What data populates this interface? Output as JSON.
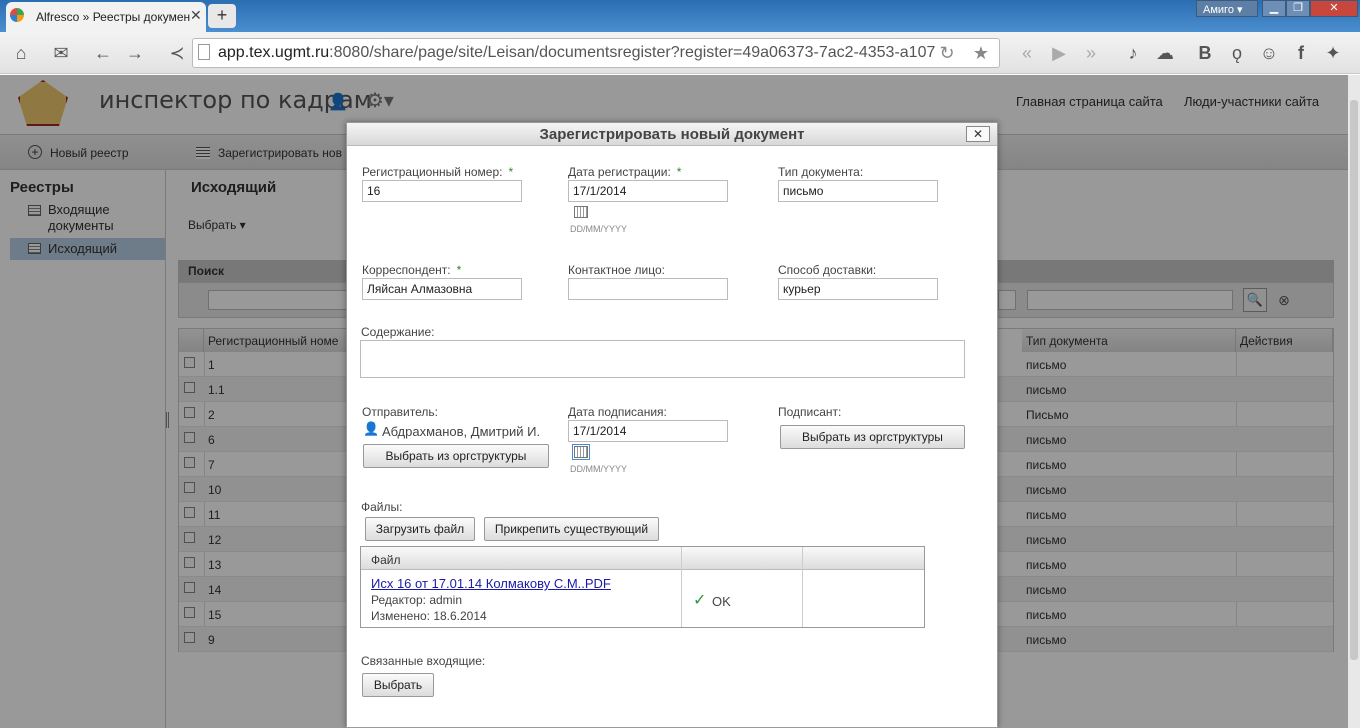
{
  "browser": {
    "tab_title": "Alfresco » Реестры докумен",
    "user_badge": "Амиго",
    "address": {
      "host": "app.tex.ugmt.ru",
      "rest": ":8080/share/page/site/Leisan/documentsregister?register=49a06373-7ac2-4353-a107"
    },
    "icons": [
      "home-icon",
      "mail-icon",
      "back-icon",
      "forward-icon",
      "share-icon",
      "page-icon",
      "reload-icon",
      "star-icon",
      "rewind-icon",
      "play-icon",
      "fast-forward-icon",
      "music-icon",
      "chat-icon",
      "vk-icon",
      "odnoklassniki-icon",
      "people-icon",
      "facebook-icon",
      "twitter-icon"
    ]
  },
  "header": {
    "site_title": "инспектор по кадрам",
    "nav": {
      "home": "Главная страница сайта",
      "people": "Люди-участники сайта"
    }
  },
  "subbar": {
    "new_register": "Новый реестр",
    "register_document": "Зарегистрировать нов"
  },
  "left_nav": {
    "heading": "Реестры",
    "items": [
      {
        "label": "Входящие документы"
      },
      {
        "label": "Исходящий"
      }
    ]
  },
  "main": {
    "title": "Исходящий",
    "select_label": "Выбрать",
    "search_label": "Поиск",
    "columns": [
      "Регистрационный номе",
      "Тип документа",
      "Действия"
    ],
    "rows": [
      {
        "num": "1",
        "type": "письмо"
      },
      {
        "num": "1.1",
        "type": "письмо"
      },
      {
        "num": "2",
        "type": "Письмо"
      },
      {
        "num": "6",
        "type": "письмо"
      },
      {
        "num": "7",
        "type": "письмо"
      },
      {
        "num": "10",
        "type": "письмо"
      },
      {
        "num": "11",
        "type": "письмо"
      },
      {
        "num": "12",
        "type": "письмо"
      },
      {
        "num": "13",
        "type": "письмо"
      },
      {
        "num": "14",
        "type": "письмо"
      },
      {
        "num": "15",
        "type": "письмо"
      },
      {
        "num": "9",
        "type": "письмо"
      }
    ]
  },
  "dialog": {
    "title": "Зарегистрировать новый документ",
    "close": "✕",
    "reg_number": {
      "label": "Регистрационный номер:",
      "value": "16",
      "required": "*"
    },
    "reg_date": {
      "label": "Дата регистрации:",
      "value": "17/1/2014",
      "required": "*",
      "format": "DD/MM/YYYY"
    },
    "doc_type": {
      "label": "Тип документа:",
      "value": "письмо"
    },
    "correspondent": {
      "label": "Корреспондент:",
      "value": "Ляйсан Алмазовна",
      "required": "*"
    },
    "contact": {
      "label": "Контактное лицо:",
      "value": ""
    },
    "delivery": {
      "label": "Способ доставки:",
      "value": "курьер"
    },
    "content": {
      "label": "Содержание:",
      "value": ""
    },
    "sender": {
      "label": "Отправитель:",
      "value": "Абдрахманов, Дмитрий И.",
      "button": "Выбрать из оргструктуры"
    },
    "sign_date": {
      "label": "Дата подписания:",
      "value": "17/1/2014",
      "format": "DD/MM/YYYY"
    },
    "signer": {
      "label": "Подписант:",
      "button": "Выбрать из оргструктуры"
    },
    "files": {
      "label": "Файлы:",
      "upload": "Загрузить файл",
      "attach": "Прикрепить существующий",
      "col_file": "Файл",
      "item": {
        "name": "Исх 16 от 17.01.14 Колмакову С.М..PDF",
        "editor": "Редактор: admin",
        "modified": "Изменено: 18.6.2014",
        "status": "OK"
      }
    },
    "related": {
      "label": "Связанные входящие:",
      "button": "Выбрать"
    }
  }
}
